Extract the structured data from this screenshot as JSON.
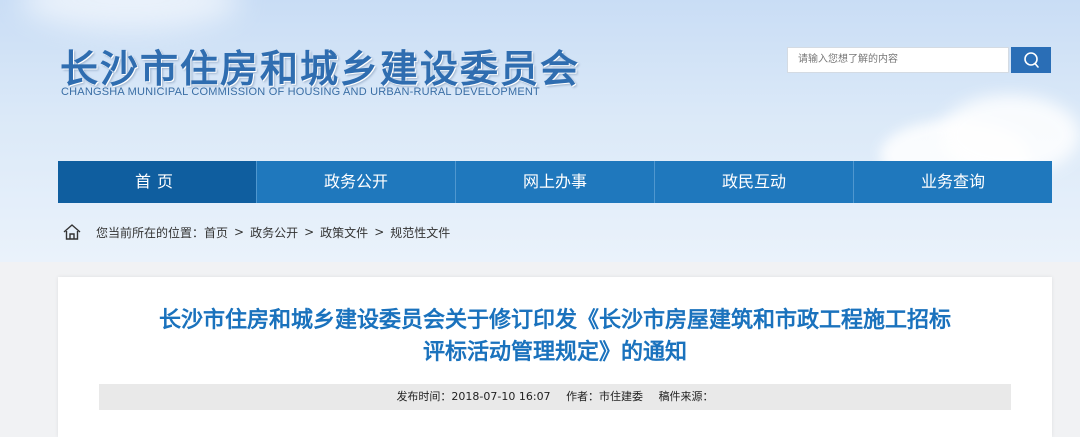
{
  "header": {
    "title": "长沙市住房和城乡建设委员会",
    "subtitle": "CHANGSHA MUNICIPAL COMMISSION OF HOUSING AND URBAN-RURAL DEVELOPMENT"
  },
  "search": {
    "placeholder": "请输入您想了解的内容",
    "button_icon": "search-icon"
  },
  "nav": {
    "items": [
      {
        "label": "首页"
      },
      {
        "label": "政务公开"
      },
      {
        "label": "网上办事"
      },
      {
        "label": "政民互动"
      },
      {
        "label": "业务查询"
      }
    ],
    "active_index": 0
  },
  "breadcrumb": {
    "prefix": "您当前所在的位置：",
    "items": [
      "首页",
      "政务公开",
      "政策文件",
      "规范性文件"
    ],
    "separator": ">"
  },
  "article": {
    "title_line1": "长沙市住房和城乡建设委员会关于修订印发《长沙市房屋建筑和市政工程施工招标",
    "title_line2": "评标活动管理规定》的通知",
    "publish_time": "发布时间：2018-07-10 16:07",
    "author": "作者：市住建委",
    "source": "稿件来源："
  },
  "colors": {
    "brand": "#1f78bd",
    "nav_active": "#0f5e9f",
    "title_blue": "#1a72bd"
  }
}
